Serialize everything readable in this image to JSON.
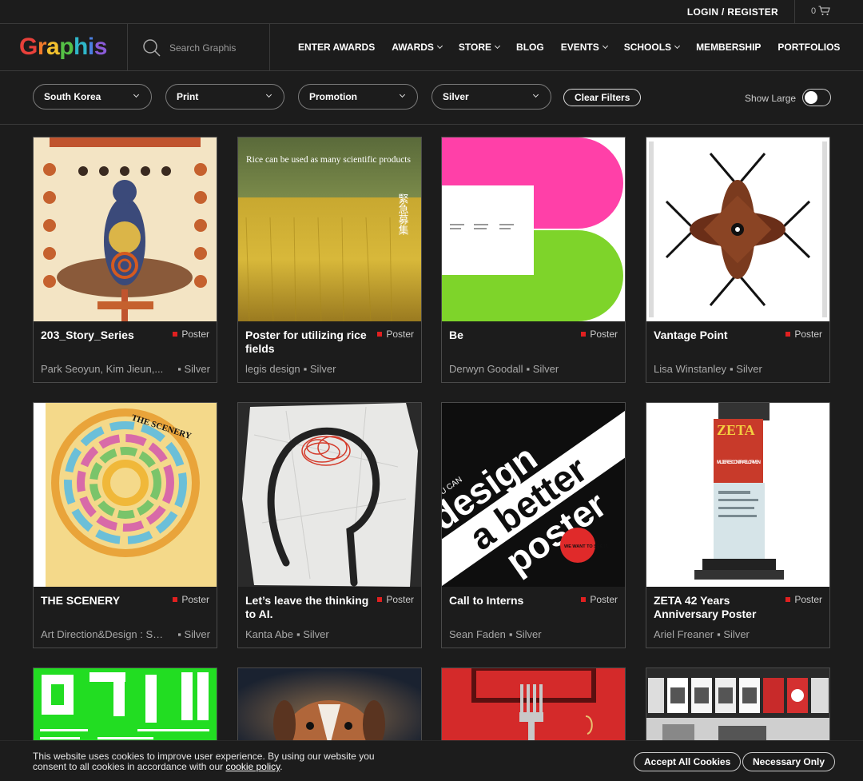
{
  "topbar": {
    "login_label": "LOGIN / REGISTER",
    "cart_count": "0"
  },
  "nav": {
    "logo": [
      "G",
      "r",
      "a",
      "p",
      "h",
      "i",
      "s"
    ],
    "search_placeholder": "Search Graphis",
    "items": [
      {
        "label": "ENTER AWARDS"
      },
      {
        "label": "AWARDS"
      },
      {
        "label": "STORE"
      },
      {
        "label": "BLOG"
      },
      {
        "label": "EVENTS"
      },
      {
        "label": "SCHOOLS"
      },
      {
        "label": "MEMBERSHIP"
      },
      {
        "label": "PORTFOLIOS"
      }
    ]
  },
  "filters": {
    "country": "South Korea",
    "discipline": "Print",
    "category": "Promotion",
    "award": "Silver",
    "clear_label": "Clear Filters",
    "show_large_label": "Show Large",
    "show_large_on": false
  },
  "cards": [
    {
      "title": "203_Story_Series",
      "type": "Poster",
      "author": "Park Seoyun, Kim Jieun,...",
      "award": "Silver"
    },
    {
      "title": "Poster for utilizing rice fields",
      "type": "Poster",
      "author": "legis design",
      "award": "Silver",
      "thumb_text_1": "Rice can be used as many scientific products",
      "thumb_text_2": "緊急募集"
    },
    {
      "title": "Be",
      "type": "Poster",
      "author": "Derwyn Goodall",
      "award": "Silver"
    },
    {
      "title": "Vantage Point",
      "type": "Poster",
      "author": "Lisa Winstanley",
      "award": "Silver"
    },
    {
      "title": "THE SCENERY",
      "type": "Poster",
      "author": "Art Direction&Design : Sei...",
      "award": "Silver",
      "thumb_text_1": "THE SCENERY"
    },
    {
      "title": "Let’s leave the thinking to AI.",
      "type": "Poster",
      "author": "Kanta Abe",
      "award": "Silver"
    },
    {
      "title": "Call to Interns",
      "type": "Poster",
      "author": "Sean Faden",
      "award": "Silver",
      "thumb_text_1": "IF YOU CAN",
      "thumb_text_2": "design",
      "thumb_text_3": "a better",
      "thumb_text_4": "poster",
      "thumb_text_5": "WE WANT TO SEE IT."
    },
    {
      "title": "ZETA 42 Years Anniversary Poster",
      "type": "Poster",
      "author": "Ariel Freaner",
      "award": "Silver",
      "thumb_text_1": "ZETA",
      "thumb_text_2": "MUJERES CONTRA EL CRIMEN"
    },
    {
      "title": "",
      "type": "",
      "author": "",
      "award": ""
    },
    {
      "title": "",
      "type": "",
      "author": "",
      "award": ""
    },
    {
      "title": "",
      "type": "",
      "author": "",
      "award": ""
    },
    {
      "title": "",
      "type": "",
      "author": "",
      "award": ""
    }
  ],
  "cookie": {
    "message": "This website uses cookies to improve user experience. By using our website you consent to all cookies in accordance with our",
    "link": "cookie policy",
    "period": ".",
    "accept_label": "Accept All Cookies",
    "necessary_label": "Necessary Only"
  }
}
